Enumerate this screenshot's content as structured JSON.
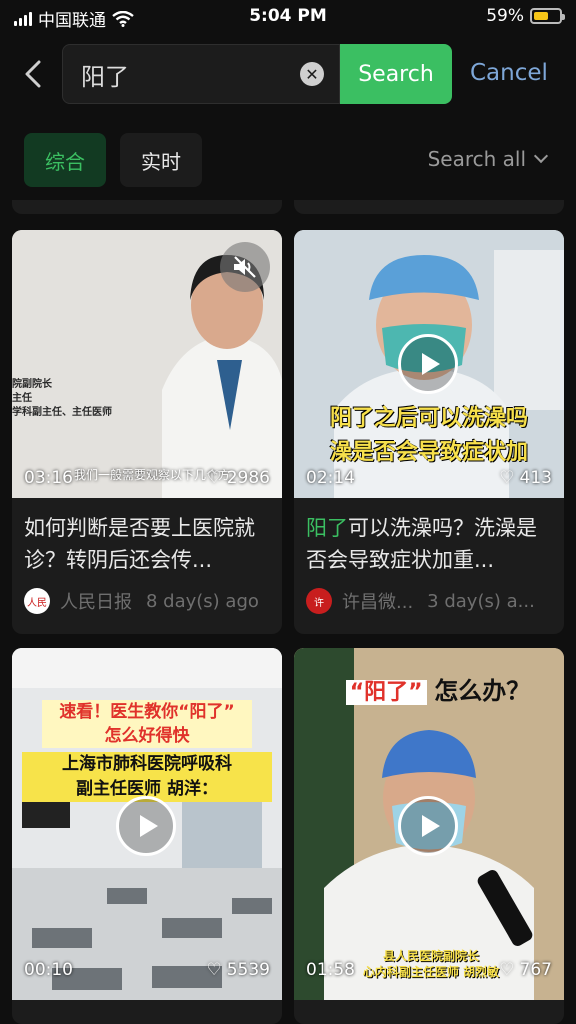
{
  "status_bar": {
    "carrier": "中国联通",
    "time": "5:04 PM",
    "battery": "59%",
    "battery_level": 0.59
  },
  "search": {
    "query": "阳了",
    "button": "Search",
    "cancel": "Cancel"
  },
  "tabs": [
    {
      "label": "综合",
      "active": true
    },
    {
      "label": "实时",
      "active": false
    }
  ],
  "search_all": "Search all",
  "colors": {
    "accent": "#3bbf62",
    "link": "#7ea7d8",
    "background": "#0f0f0f",
    "card": "#1c1c1c"
  },
  "cards": [
    {
      "duration": "03:16",
      "likes": "2986",
      "title": "如何判断是否要上医院就诊？转阴后还会传...",
      "source": "人民日报",
      "age": "8 day(s) ago",
      "thumb_caption": "我们一般需要观察以下几个方",
      "thumb_text": [
        "院副院长",
        "主任",
        "学科副主任、主任医师"
      ]
    },
    {
      "duration": "02:14",
      "likes": "413",
      "title_highlight": "阳了",
      "title_rest": "可以洗澡吗？洗澡是否会导致症状加重...",
      "source": "许昌微...",
      "age": "3 day(s) a...",
      "thumb_caption": [
        "阳了之后可以洗澡吗",
        "澡是否会导致症状加"
      ]
    },
    {
      "duration": "00:10",
      "likes": "5539",
      "thumb_caption": [
        "速看！医生教你“阳了”",
        "怎么好得快",
        "上海市肺科医院呼吸科",
        "副主任医师  胡洋："
      ]
    },
    {
      "duration": "01:58",
      "likes": "767",
      "thumb_caption": [
        "“阳了”",
        "怎么办？",
        "县人民医院副院长",
        "心内科副主任医师  胡烈敏"
      ]
    }
  ]
}
